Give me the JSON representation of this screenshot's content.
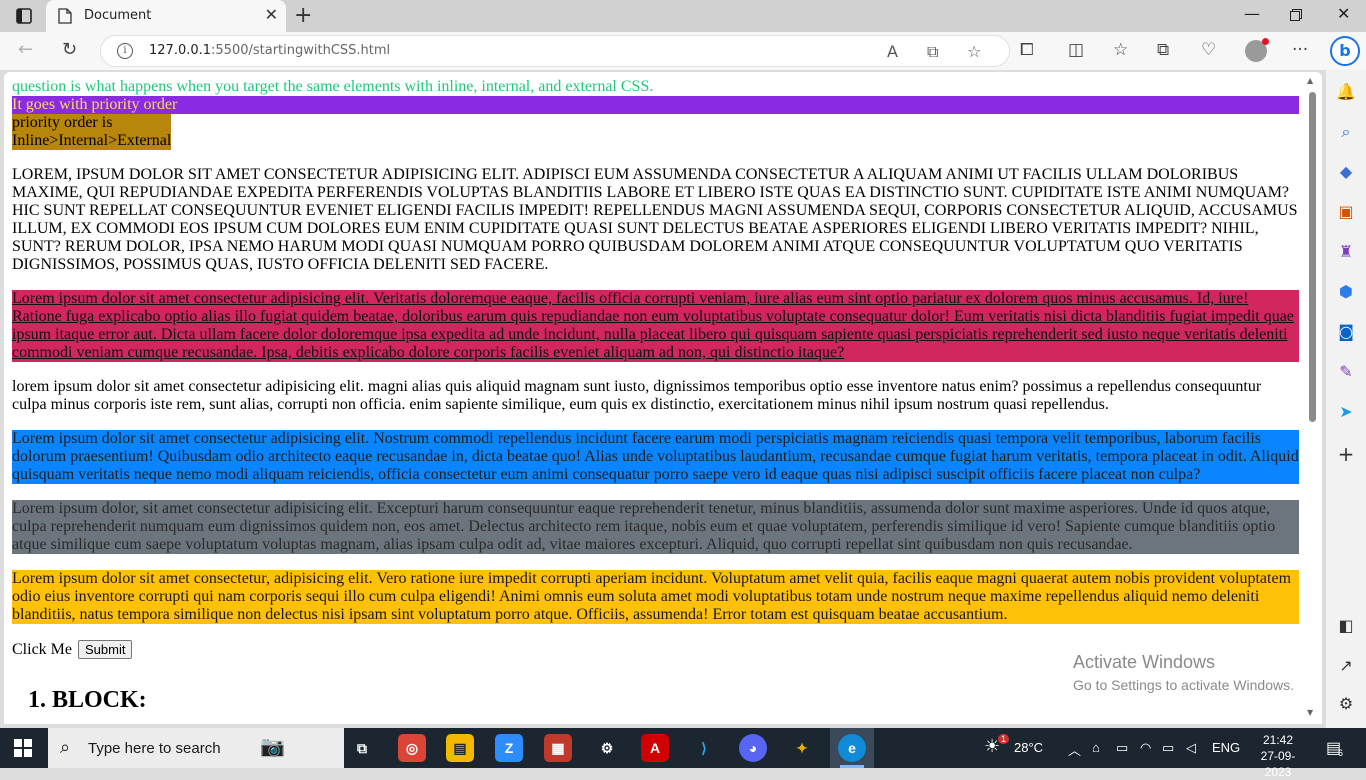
{
  "browser": {
    "tab_title": "Document",
    "url_host": "127.0.0.1",
    "url_path": ":5500/startingwithCSS.html",
    "watermark": {
      "title": "Activate Windows",
      "subtitle": "Go to Settings to activate Windows."
    }
  },
  "page": {
    "p_green": "question is what happens when you target the same elements with inline, internal, and external CSS.",
    "p_purple": "It goes with priority order",
    "p_gold_line1": "priority order is",
    "p_gold_line2": "Inline>Internal>External",
    "p_upper": "Lorem, ipsum dolor sit amet consectetur adipisicing elit. Adipisci eum assumenda consectetur a aliquam animi ut facilis ullam doloribus maxime, qui repudiandae expedita perferendis voluptas blanditiis labore et libero iste quas ea distinctio sunt. Cupiditate iste animi numquam? Hic sunt repellat consequuntur eveniet eligendi facilis impedit! Repellendus magni assumenda sequi, corporis consectetur aliquid, accusamus illum, ex commodi eos ipsum cum dolores eum enim cupiditate quasi sunt delectus beatae asperiores eligendi libero veritatis impedit? Nihil, sunt? Rerum dolor, ipsa nemo harum modi quasi numquam porro quibusdam dolorem animi atque consequuntur voluptatum quo veritatis dignissimos, possimus quas, iusto officia deleniti sed facere.",
    "p_crimson": "Lorem ipsum dolor sit amet consectetur adipisicing elit. Veritatis doloremque eaque, facilis officia corrupti veniam, iure alias eum sint optio pariatur ex dolorem quos minus accusamus. Id, iure! Ratione fuga explicabo optio alias illo fugiat quidem beatae, doloribus earum quis repudiandae non eum voluptatibus voluptate consequatur dolor! Eum veritatis nisi dicta blanditiis fugiat impedit quae ipsum itaque error aut. Dicta ullam facere dolor doloremque ipsa expedita ad unde incidunt, nulla placeat libero qui quisquam sapiente quasi perspiciatis reprehenderit sed iusto neque veritatis deleniti commodi veniam cumque recusandae. Ipsa, debitis explicabo dolore corporis facilis eveniet aliquam ad non, qui distinctio itaque?",
    "p_lower": "lorem ipsum dolor sit amet consectetur adipisicing elit. magni alias quis aliquid magnam sunt iusto, dignissimos temporibus optio esse inventore natus enim? possimus a repellendus consequuntur culpa minus corporis iste rem, sunt alias, corrupti non officia. enim sapiente similique, eum quis ex distinctio, exercitationem minus nihil ipsum nostrum quasi repellendus.",
    "p_blue": "Lorem ipsum dolor sit amet consectetur adipisicing elit. Nostrum commodi repellendus incidunt facere earum modi perspiciatis magnam reiciendis quasi tempora velit temporibus, laborum facilis dolorum praesentium! Quibusdam odio architecto eaque recusandae in, dicta beatae quo! Alias unde voluptatibus laudantium, recusandae cumque fugiat harum veritatis, tempora placeat in odit. Aliquid quisquam veritatis neque nemo modi aliquam reiciendis, officia consectetur eum animi consequatur porro saepe vero id eaque quas nisi adipisci suscipit officiis facere placeat non culpa?",
    "p_grey": "Lorem ipsum dolor, sit amet consectetur adipisicing elit. Excepturi harum consequuntur eaque reprehenderit tenetur, minus blanditiis, assumenda dolor sunt maxime asperiores. Unde id quos atque, culpa reprehenderit numquam eum dignissimos quidem non, eos amet. Delectus architecto rem itaque, nobis eum et quae voluptatem, perferendis similique id vero! Sapiente cumque blanditiis optio atque similique cum saepe voluptatum voluptas magnam, alias ipsam culpa odit ad, vitae maiores excepturi. Aliquid, quo corrupti repellat sint quibusdam non quis recusandae.",
    "p_yellow": "Lorem ipsum dolor sit amet consectetur, adipisicing elit. Vero ratione iure impedit corrupti aperiam incidunt. Voluptatum amet velit quia, facilis eaque magni quaerat autem nobis provident voluptatem odio eius inventore corrupti qui nam corporis sequi illo cum culpa eligendi! Animi omnis eum soluta amet modi voluptatibus totam unde nostrum neque maxime repellendus aliquid nemo deleniti blanditiis, natus tempora similique non delectus nisi ipsam sint voluptatum porro atque. Officiis, assumenda! Error totam est quisquam beatae accusantium.",
    "click_label": "Click Me",
    "submit_label": "Submit",
    "heading": "1. BLOCK:"
  },
  "taskbar": {
    "search_placeholder": "Type here to search",
    "weather_temp": "28°C",
    "language": "ENG",
    "time": "21:42",
    "date": "27-09-2023",
    "notification_count": "6",
    "weather_badge": "1"
  },
  "colors": {
    "purple": "#8a2be2",
    "gold": "#b8860b",
    "crimson": "#d2265f",
    "blue": "#0a84ff",
    "grey": "#6c757d",
    "yellow": "#ffc107",
    "green_text": "#1ec97a"
  },
  "icons": [
    "tab-actions-icon",
    "document-icon",
    "close-icon",
    "plus-icon",
    "minimize-icon",
    "maximize-icon",
    "back-icon",
    "refresh-icon",
    "info-icon",
    "read-aloud-icon",
    "app-available-icon",
    "favorite-icon",
    "extensions-icon",
    "split-screen-icon",
    "favorites-icon",
    "collections-icon",
    "browser-essentials-icon",
    "profile-icon",
    "more-icon",
    "bing-copilot-icon",
    "bell-icon",
    "search-icon",
    "shopping-icon",
    "tools-icon",
    "games-icon",
    "office-icon",
    "outlook-icon",
    "designer-icon",
    "send-icon",
    "add-icon",
    "sidebar-toggle-icon",
    "open-external-icon",
    "settings-icon",
    "windows-start-icon"
  ]
}
